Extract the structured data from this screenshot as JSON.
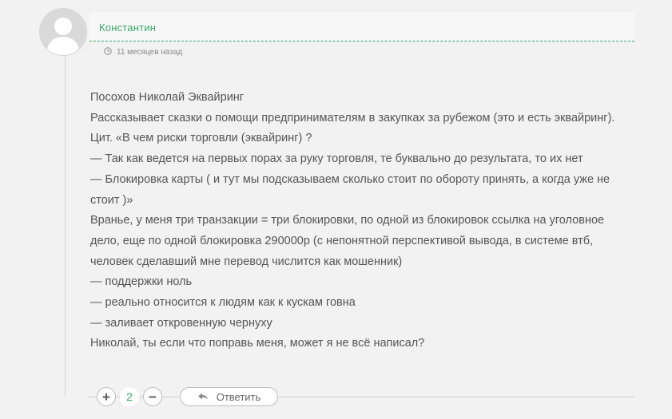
{
  "comment": {
    "author": "Константин",
    "time": "11 месяцев назад",
    "lines": [
      "Посохов Николай Эквайринг",
      "Рассказывает сказки о помощи предпринимателям в закупках за рубежом (это и есть эквайринг).",
      "Цит. «В чем риски торговли (эквайринг) ?",
      "— Так как ведется на первых порах за руку торговля, те буквально до результата, то их нет",
      "— Блокировка карты ( и тут мы подсказываем сколько стоит по обороту принять, а когда уже не стоит )»",
      "Вранье, у меня три транзакции = три блокировки, по одной из блокировок ссылка на уголовное дело, еще по одной блокировка 290000р (с непонятной перспективой вывода, в системе втб, человек сделавший мне перевод числится как мошенник)",
      "— поддержки ноль",
      "— реально относится к людям как к кускам говна",
      "— заливает откровенную чернуху",
      "Николай, ты если что поправь меня, может я не всё написал?"
    ]
  },
  "votes": {
    "plus_label": "+",
    "count": "2",
    "minus_label": "−"
  },
  "reply": {
    "label": "Ответить"
  },
  "colors": {
    "accent": "#3aa76d",
    "background": "#f2f2f2",
    "text": "#555555"
  },
  "icons": {
    "avatar": "default-user-avatar",
    "time": "clock-icon",
    "reply": "reply-arrow-icon"
  }
}
